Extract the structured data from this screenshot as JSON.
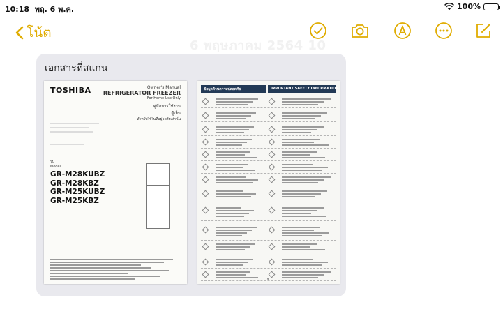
{
  "status_bar": {
    "time": "10:18",
    "date": "พฤ. 6 พ.ค.",
    "battery": "100%"
  },
  "nav": {
    "back_label": "โน้ต",
    "ghost_title": "6 พฤษภาคม 2564 10",
    "accent_color": "#e0ac00",
    "tools": [
      "checklist-icon",
      "camera-icon",
      "markup-pen-icon",
      "more-icon",
      "compose-icon"
    ]
  },
  "scan": {
    "title": "เอกสารที่สแกน",
    "page1": {
      "brand": "TOSHIBA",
      "manual_line1": "Owner's Manual",
      "manual_line2": "REFRIGERATOR FREEZER",
      "manual_line3": "For Home Use Only",
      "thai_line1": "คู่มือการใช้งาน",
      "thai_line2": "ตู้เย็น",
      "thai_line3": "สำหรับใช้ในที่อยู่อาศัยเท่านั้น",
      "model_label_th": "รุ่น",
      "model_label_en": "Model",
      "models": [
        "GR-M28KUBZ",
        "GR-M28KBZ",
        "GR-M25KUBZ",
        "GR-M25KBZ"
      ]
    },
    "page2": {
      "header_th": "ข้อมูลด้านความปลอดภัย",
      "header_en": "IMPORTANT SAFETY INFORMATION"
    }
  }
}
